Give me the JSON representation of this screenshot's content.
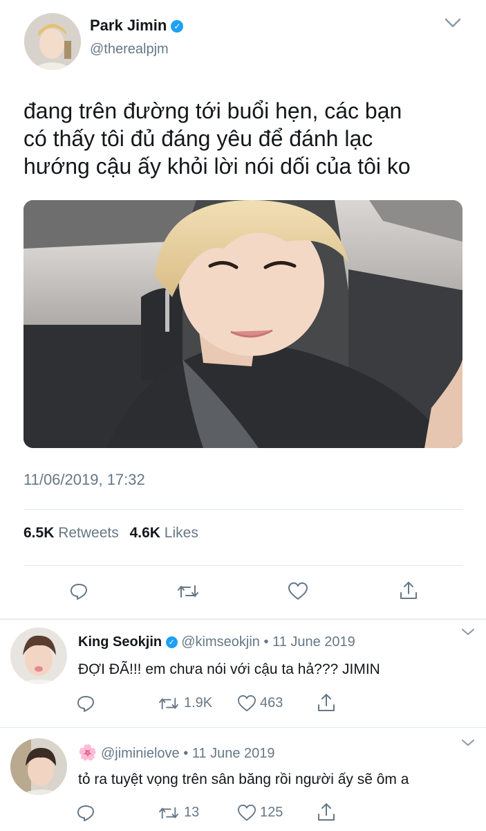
{
  "main_tweet": {
    "author_name": "Park Jimin",
    "handle": "@therealpjm",
    "text_lines": [
      "đang trên đường tới buổi hẹn, các bạn",
      "có thấy tôi đủ đáng yêu để đánh lạc",
      "hướng cậu ấy khỏi lời nói dối của tôi ko"
    ],
    "timestamp": "11/06/2019, 17:32",
    "retweets_count": "6.5K",
    "retweets_label": "Retweets",
    "likes_count": "4.6K",
    "likes_label": "Likes"
  },
  "replies": [
    {
      "author_name": "King Seokjin",
      "handle": "@kimseokjin",
      "separator": "•",
      "date": "11 June 2019",
      "text": "ĐỢI ĐÃ!!! em chưa nói với cậu ta hả??? JIMIN",
      "retweets": "1.9K",
      "likes": "463"
    },
    {
      "author_emoji": "🌸",
      "handle": "@jiminielove",
      "separator": "•",
      "date": "11 June 2019",
      "text": "tỏ ra tuyệt vọng trên sân băng rồi người ấy sẽ ôm a",
      "retweets": "13",
      "likes": "125"
    }
  ],
  "colors": {
    "verified": "#1da1f2",
    "muted": "#657786",
    "divider": "#e1e8ed",
    "text": "#14171a"
  }
}
